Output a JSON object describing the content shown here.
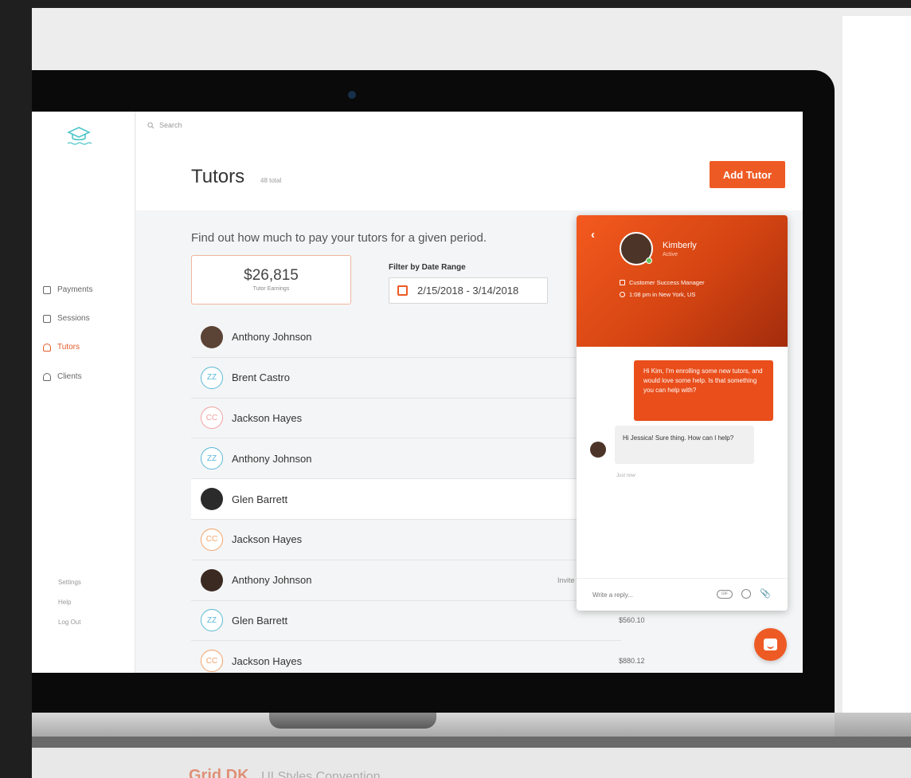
{
  "search": {
    "placeholder": "Search"
  },
  "sidebar": {
    "items": [
      {
        "label": "Payments",
        "active": false
      },
      {
        "label": "Sessions",
        "active": false
      },
      {
        "label": "Tutors",
        "active": true
      },
      {
        "label": "Clients",
        "active": false
      }
    ],
    "footer_links": [
      "Settings",
      "Help",
      "Log Out"
    ]
  },
  "header": {
    "title": "Tutors",
    "count": "48 total",
    "add_button": "Add Tutor"
  },
  "main": {
    "subtitle": "Find out how much to pay your tutors for a given period.",
    "earnings": {
      "amount": "$26,815",
      "label": "Tutor Earnings"
    },
    "filter": {
      "label": "Filter by Date Range",
      "value": "2/15/2018 - 3/14/2018"
    }
  },
  "tutors": [
    {
      "name": "Anthony Johnson",
      "avatar": "photo",
      "initials": "",
      "color": "#5b4335",
      "meta": "",
      "amount": ""
    },
    {
      "name": "Brent Castro",
      "avatar": "initials",
      "initials": "ZZ",
      "color": "#5bb8d8",
      "meta": "",
      "amount": ""
    },
    {
      "name": "Jackson Hayes",
      "avatar": "initials",
      "initials": "CC",
      "color": "#f0a0a0",
      "meta": "",
      "amount": ""
    },
    {
      "name": "Anthony Johnson",
      "avatar": "initials",
      "initials": "ZZ",
      "color": "#5bb8d8",
      "meta": "",
      "amount": ""
    },
    {
      "name": "Glen Barrett",
      "avatar": "photo",
      "initials": "",
      "color": "#2b2b2b",
      "meta": "",
      "amount": ""
    },
    {
      "name": "Jackson Hayes",
      "avatar": "initials",
      "initials": "CC",
      "color": "#f0a36a",
      "meta": "",
      "amount": ""
    },
    {
      "name": "Anthony Johnson",
      "avatar": "photo",
      "initials": "",
      "color": "#3a2a22",
      "meta": "Invite",
      "amount": ""
    },
    {
      "name": "Glen Barrett",
      "avatar": "initials",
      "initials": "ZZ",
      "color": "#5bb8d8",
      "meta": "",
      "amount": "$560.10"
    },
    {
      "name": "Jackson Hayes",
      "avatar": "initials",
      "initials": "CC",
      "color": "#f0a36a",
      "meta": "",
      "amount": "$880.12"
    }
  ],
  "chat": {
    "name": "Kimberly",
    "status": "Active",
    "role": "Customer Success Manager",
    "local_time": "1:08 pm in New York, US",
    "messages": [
      {
        "from": "user",
        "text": "Hi Kim, I'm enrolling some new tutors, and would love some help. Is that something you can help with?"
      },
      {
        "from": "agent",
        "text": "Hi Jessica! Sure thing. How can I help?"
      }
    ],
    "timestamp": "Just now",
    "reply_placeholder": "Write a reply..."
  },
  "icons": {
    "logo": "graduation-cap-icon",
    "nav": [
      "payments-icon",
      "sessions-icon",
      "tutors-icon",
      "clients-icon"
    ]
  },
  "colors": {
    "accent": "#ee5a24",
    "accent_dark": "#a32c0c"
  },
  "branding": {
    "caption_bold": "Grid DK",
    "caption_rest": "UI Styles Convention"
  }
}
